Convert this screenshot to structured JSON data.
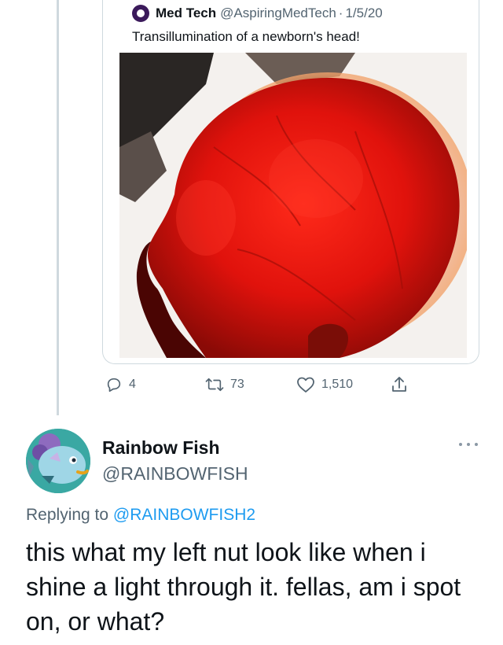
{
  "quoted_tweet": {
    "author_name": "Med Tech",
    "author_handle": "@AspiringMedTech",
    "separator": "·",
    "date": "1/5/20",
    "text": "Transillumination of a newborn's head!",
    "media_icon": "newborn-head-transillumination-photo"
  },
  "actions": {
    "reply_count": "4",
    "retweet_count": "73",
    "like_count": "1,510",
    "icons": [
      "reply-icon",
      "retweet-icon",
      "like-icon",
      "share-icon"
    ]
  },
  "reply_tweet": {
    "author_name": "Rainbow Fish",
    "author_handle": "@RAINBOWFISH",
    "replying_prefix": "Replying to",
    "replying_to": "@RAINBOWFISH2",
    "text": "this what my left nut look like when i shine a light through it. fellas, am i spot on, or what?"
  },
  "colors": {
    "link": "#1d9bf0",
    "secondary_text": "#536471",
    "border": "#cfd9de",
    "primary_text": "#0f1419"
  }
}
